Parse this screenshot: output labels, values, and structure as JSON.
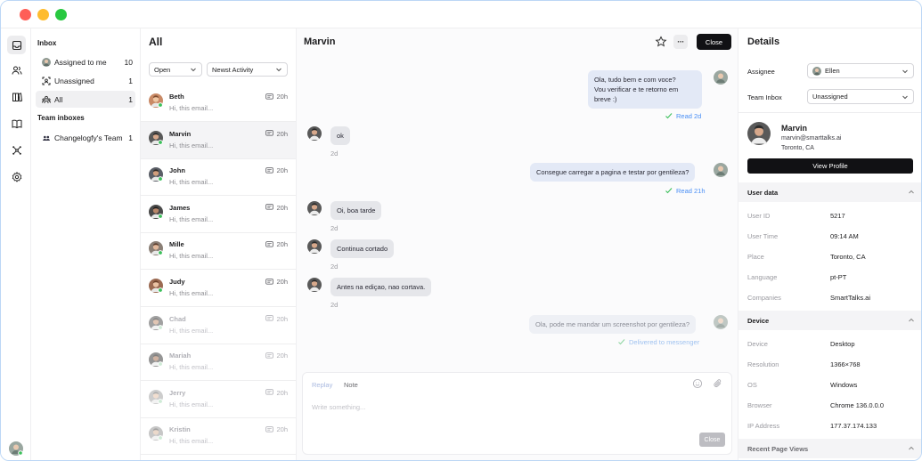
{
  "sidebar": {
    "inbox_heading": "Inbox",
    "items": [
      {
        "label": "Assigned to me",
        "count": "10"
      },
      {
        "label": "Unassigned",
        "count": "1"
      },
      {
        "label": "All",
        "count": "1"
      }
    ],
    "team_heading": "Team inboxes",
    "teams": [
      {
        "label": "Changelogfy's Team",
        "count": "1"
      }
    ]
  },
  "list": {
    "title": "All",
    "status_filter": "Open",
    "sort_filter": "Newst Activity",
    "conversations": [
      {
        "name": "Beth",
        "preview": "Hi, this email...",
        "time": "20h"
      },
      {
        "name": "Marvin",
        "preview": "Hi, this email...",
        "time": "20h"
      },
      {
        "name": "John",
        "preview": "Hi, this email...",
        "time": "20h"
      },
      {
        "name": "James",
        "preview": "Hi, this email...",
        "time": "20h"
      },
      {
        "name": "Mille",
        "preview": "Hi, this email...",
        "time": "20h"
      },
      {
        "name": "Judy",
        "preview": "Hi, this email...",
        "time": "20h"
      },
      {
        "name": "Chad",
        "preview": "Hi, this email...",
        "time": "20h"
      },
      {
        "name": "Mariah",
        "preview": "Hi, this email...",
        "time": "20h"
      },
      {
        "name": "Jerry",
        "preview": "Hi, this email...",
        "time": "20h"
      },
      {
        "name": "Kristin",
        "preview": "Hi, this email...",
        "time": "20h"
      }
    ]
  },
  "chat": {
    "title": "Marvin",
    "close_label": "Close",
    "more_label": "···",
    "messages": [
      {
        "text_lines": [
          "Ola, tudo bem e com voce?",
          "Vou verificar e te retorno em",
          "breve :)"
        ],
        "meta": "Read 2d"
      },
      {
        "text": "ok",
        "meta": "2d"
      },
      {
        "text": "Consegue carregar a pagina e testar por gentileza?",
        "meta": "Read 21h"
      },
      {
        "text": "Oi, boa tarde",
        "meta": "2d"
      },
      {
        "text": "Continua cortado",
        "meta": "2d"
      },
      {
        "text": "Antes na ediçao, nao cortava.",
        "meta": "2d"
      },
      {
        "text": "Ola, pode me mandar um screenshot por gentileza?",
        "meta": "Delivered to messenger"
      }
    ],
    "composer": {
      "reply_tab": "Replay",
      "note_tab": "Note",
      "placeholder": "Write something...",
      "close_label": "Close"
    }
  },
  "details": {
    "title": "Details",
    "assignee_label": "Assignee",
    "assignee_value": "Ellen",
    "team_inbox_label": "Team Inbox",
    "team_inbox_value": "Unassigned",
    "profile": {
      "name": "Marvin",
      "email": "marvin@smarttalks.ai",
      "location": "Toronto, CA",
      "view_profile_label": "View Profile"
    },
    "user_data_heading": "User data",
    "user_data": [
      {
        "key": "User ID",
        "value": "5217"
      },
      {
        "key": "User Time",
        "value": "09:14 AM"
      },
      {
        "key": "Place",
        "value": "Toronto, CA"
      },
      {
        "key": "Language",
        "value": "pt-PT"
      },
      {
        "key": "Companies",
        "value": "SmartTalks.ai"
      }
    ],
    "device_heading": "Device",
    "device": [
      {
        "key": "Device",
        "value": "Desktop"
      },
      {
        "key": "Resolution",
        "value": "1366×768"
      },
      {
        "key": "OS",
        "value": "Windows"
      },
      {
        "key": "Browser",
        "value": "Chrome 136.0.0.0"
      },
      {
        "key": "IP Address",
        "value": "177.37.174.133"
      }
    ],
    "recent_heading": "Recent Page Views"
  },
  "colors": {
    "accent_dark": "#111114",
    "read_blue": "#4a8ff5",
    "online_green": "#3bbf5a"
  }
}
